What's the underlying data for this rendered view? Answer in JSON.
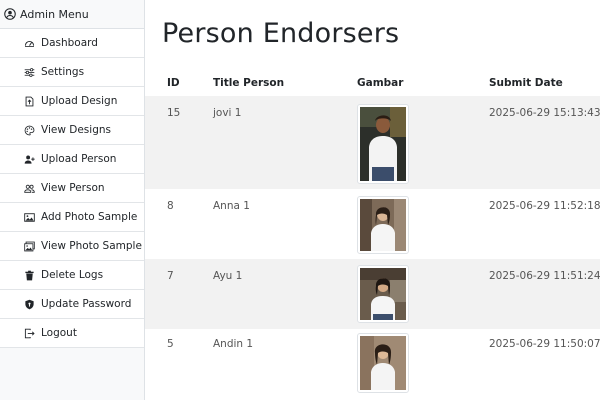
{
  "sidebar": {
    "header": "Admin Menu",
    "items": [
      {
        "label": "Dashboard",
        "icon": "dashboard-icon"
      },
      {
        "label": "Settings",
        "icon": "sliders-icon"
      },
      {
        "label": "Upload Design",
        "icon": "file-upload-icon"
      },
      {
        "label": "View Designs",
        "icon": "palette-icon"
      },
      {
        "label": "Upload Person",
        "icon": "person-add-icon"
      },
      {
        "label": "View Person",
        "icon": "people-icon"
      },
      {
        "label": "Add Photo Sample",
        "icon": "image-icon"
      },
      {
        "label": "View Photo Sample",
        "icon": "images-icon"
      },
      {
        "label": "Delete Logs",
        "icon": "trash-icon"
      },
      {
        "label": "Update Password",
        "icon": "shield-icon"
      },
      {
        "label": "Logout",
        "icon": "logout-icon"
      }
    ]
  },
  "main": {
    "title": "Person Endorsers",
    "columns": {
      "id": "ID",
      "title": "Title Person",
      "image": "Gambar",
      "date": "Submit Date"
    },
    "rows": [
      {
        "id": "15",
        "title": "jovi 1",
        "date": "2025-06-29 15:13:43"
      },
      {
        "id": "8",
        "title": "Anna 1",
        "date": "2025-06-29 11:52:18"
      },
      {
        "id": "7",
        "title": "Ayu 1",
        "date": "2025-06-29 11:51:24"
      },
      {
        "id": "5",
        "title": "Andin 1",
        "date": "2025-06-29 11:50:07"
      }
    ]
  }
}
